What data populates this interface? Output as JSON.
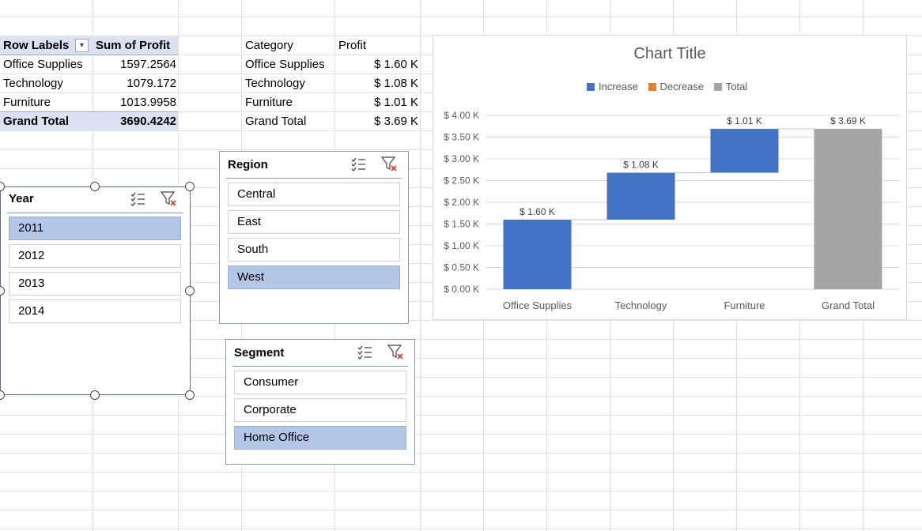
{
  "pivot_table": {
    "header_row_labels": "Row Labels",
    "header_sum": "Sum of Profit",
    "rows": [
      {
        "label": "Office Supplies",
        "value": "1597.2564"
      },
      {
        "label": "Technology",
        "value": "1079.172"
      },
      {
        "label": "Furniture",
        "value": "1013.9958"
      }
    ],
    "total_label": "Grand Total",
    "total_value": "3690.4242"
  },
  "summary_table": {
    "header_category": "Category",
    "header_profit": "Profit",
    "rows": [
      {
        "category": "Office Supplies",
        "profit": "$ 1.60 K"
      },
      {
        "category": "Technology",
        "profit": "$ 1.08 K"
      },
      {
        "category": "Furniture",
        "profit": "$ 1.01 K"
      },
      {
        "category": "Grand Total",
        "profit": "$ 3.69 K"
      }
    ]
  },
  "slicers": {
    "year": {
      "title": "Year",
      "items": [
        "2011",
        "2012",
        "2013",
        "2014"
      ],
      "selected": [
        "2011"
      ]
    },
    "region": {
      "title": "Region",
      "items": [
        "Central",
        "East",
        "South",
        "West"
      ],
      "selected": [
        "West"
      ]
    },
    "segment": {
      "title": "Segment",
      "items": [
        "Consumer",
        "Corporate",
        "Home Office"
      ],
      "selected": [
        "Home Office"
      ]
    }
  },
  "icons": {
    "multi_select": "multi-select-icon",
    "clear_filter": "clear-filter-icon",
    "sort_dropdown": "sort-dropdown-icon"
  },
  "colors": {
    "increase": "#4472c4",
    "decrease": "#ed7d31",
    "total": "#a5a5a5",
    "slicer_selected": "#b4c6e7",
    "pivot_header": "#d9e1f2"
  },
  "chart_data": {
    "type": "waterfall",
    "title": "Chart Title",
    "categories": [
      "Office Supplies",
      "Technology",
      "Furniture",
      "Grand Total"
    ],
    "values": [
      1.6,
      1.08,
      1.01,
      3.69
    ],
    "data_labels": [
      "$ 1.60 K",
      "$ 1.08 K",
      "$ 1.01 K",
      "$ 3.69 K"
    ],
    "kinds": [
      "increase",
      "increase",
      "increase",
      "total"
    ],
    "legend": [
      {
        "name": "Increase",
        "color": "#4472c4"
      },
      {
        "name": "Decrease",
        "color": "#ed7d31"
      },
      {
        "name": "Total",
        "color": "#a5a5a5"
      }
    ],
    "legend_position": "top",
    "ylim": [
      0,
      4
    ],
    "y_ticks": [
      0,
      0.5,
      1,
      1.5,
      2,
      2.5,
      3,
      3.5,
      4
    ],
    "y_tick_labels": [
      "$ 0.00 K",
      "$ 0.50 K",
      "$ 1.00 K",
      "$ 1.50 K",
      "$ 2.00 K",
      "$ 2.50 K",
      "$ 3.00 K",
      "$ 3.50 K",
      "$ 4.00 K"
    ],
    "grid": true
  }
}
